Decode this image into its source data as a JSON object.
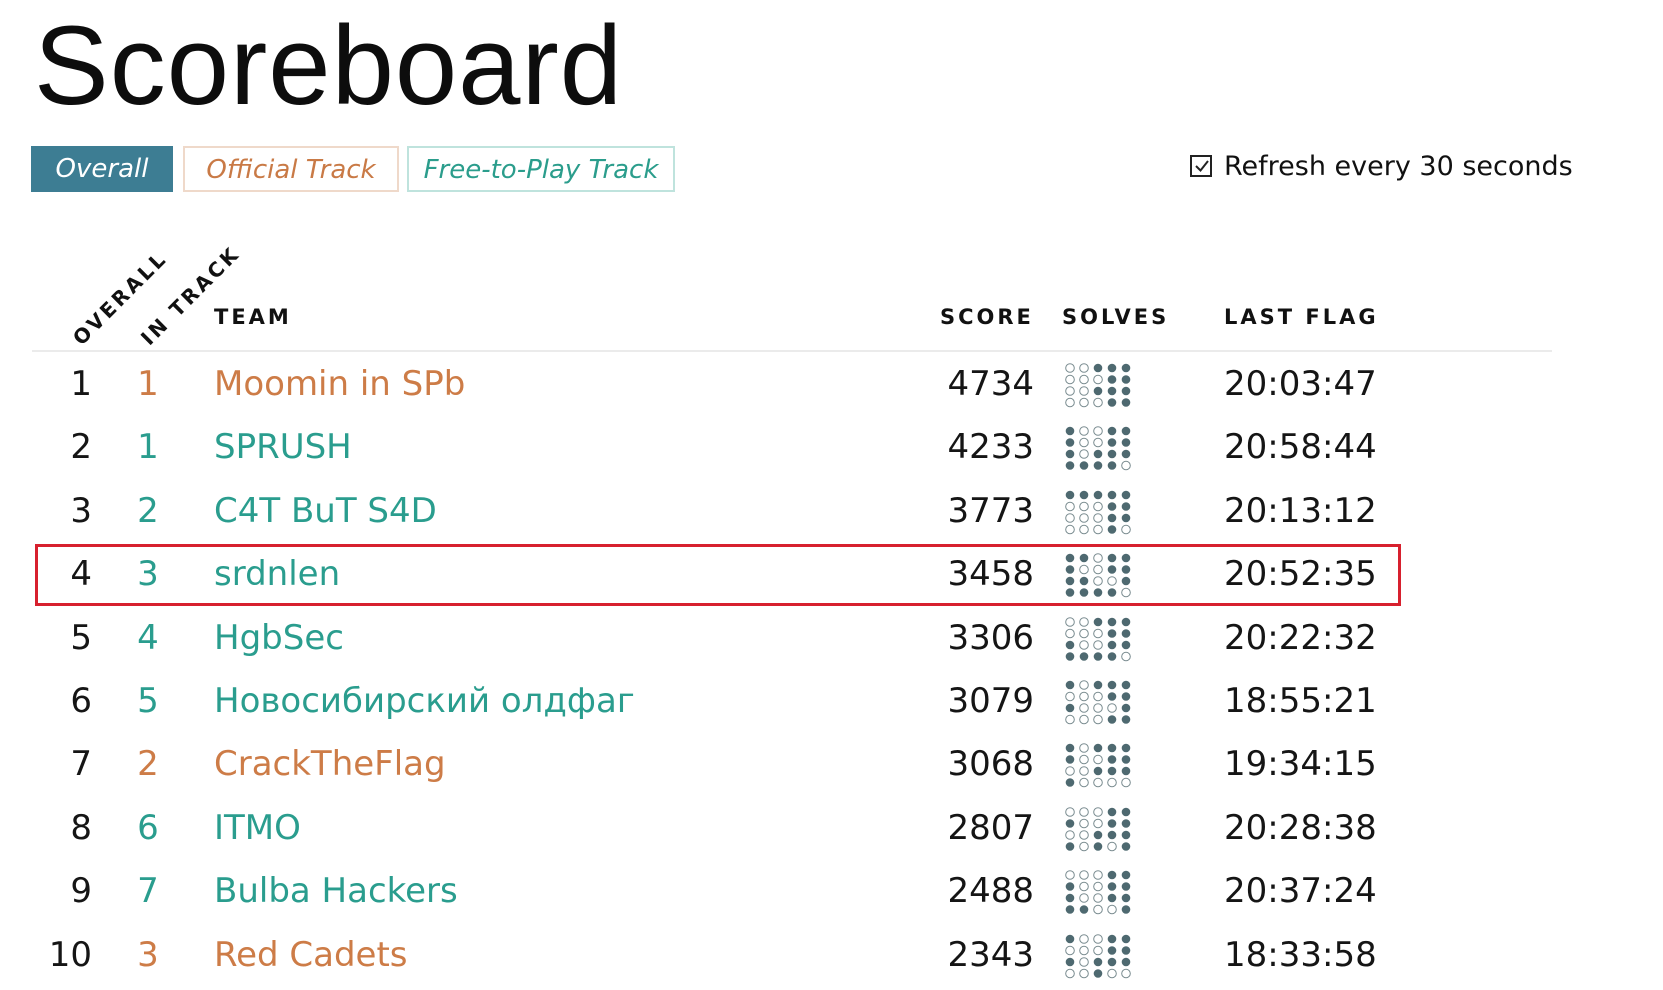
{
  "page": {
    "title": "Scoreboard"
  },
  "tabs": [
    {
      "label": "Overall",
      "active": true
    },
    {
      "label": "Official Track",
      "active": false
    },
    {
      "label": "Free-to-Play Track",
      "active": false
    }
  ],
  "refresh": {
    "label": "Refresh every 30 seconds",
    "checked": true
  },
  "columns": {
    "overall": "OVERALL",
    "in_track": "IN TRACK",
    "team": "TEAM",
    "score": "SCORE",
    "solves": "SOLVES",
    "last_flag": "LAST FLAG"
  },
  "colors": {
    "official_track": "#cd7c47",
    "free_track": "#2a9d8e",
    "active_tab": "#3d7d93",
    "solve_dot": "#4e6970",
    "highlight": "#d7202e"
  },
  "rows": [
    {
      "overall": "1",
      "in_track": "1",
      "team": "Moomin in SPb",
      "track": "official",
      "score": "4734",
      "last_flag": "20:03:47",
      "solves": [
        0,
        0,
        1,
        1,
        1,
        0,
        0,
        0,
        1,
        1,
        0,
        0,
        1,
        1,
        1,
        0,
        0,
        0,
        1,
        1
      ],
      "highlighted": false
    },
    {
      "overall": "2",
      "in_track": "1",
      "team": "SPRUSH",
      "track": "free",
      "score": "4233",
      "last_flag": "20:58:44",
      "solves": [
        1,
        0,
        0,
        1,
        1,
        1,
        0,
        0,
        1,
        1,
        1,
        0,
        1,
        1,
        1,
        1,
        1,
        1,
        1,
        0
      ],
      "highlighted": false
    },
    {
      "overall": "3",
      "in_track": "2",
      "team": "C4T BuT S4D",
      "track": "free",
      "score": "3773",
      "last_flag": "20:13:12",
      "solves": [
        1,
        1,
        1,
        1,
        1,
        0,
        0,
        0,
        1,
        1,
        0,
        0,
        0,
        1,
        1,
        0,
        0,
        0,
        1,
        0
      ],
      "highlighted": false
    },
    {
      "overall": "4",
      "in_track": "3",
      "team": "srdnlen",
      "track": "free",
      "score": "3458",
      "last_flag": "20:52:35",
      "solves": [
        1,
        1,
        0,
        1,
        1,
        1,
        0,
        0,
        1,
        1,
        1,
        1,
        0,
        0,
        1,
        1,
        1,
        1,
        1,
        0
      ],
      "highlighted": true
    },
    {
      "overall": "5",
      "in_track": "4",
      "team": "HgbSec",
      "track": "free",
      "score": "3306",
      "last_flag": "20:22:32",
      "solves": [
        0,
        0,
        1,
        1,
        1,
        0,
        0,
        0,
        1,
        1,
        1,
        0,
        0,
        1,
        1,
        1,
        1,
        1,
        1,
        0
      ],
      "highlighted": false
    },
    {
      "overall": "6",
      "in_track": "5",
      "team": "Новосибирский олдфаг",
      "track": "free",
      "score": "3079",
      "last_flag": "18:55:21",
      "solves": [
        1,
        0,
        1,
        1,
        1,
        0,
        0,
        0,
        1,
        1,
        1,
        0,
        0,
        0,
        1,
        0,
        0,
        0,
        1,
        1
      ],
      "highlighted": false
    },
    {
      "overall": "7",
      "in_track": "2",
      "team": "CrackTheFlag",
      "track": "official",
      "score": "3068",
      "last_flag": "19:34:15",
      "solves": [
        1,
        0,
        1,
        1,
        1,
        1,
        0,
        0,
        1,
        1,
        0,
        0,
        1,
        1,
        1,
        1,
        0,
        0,
        0,
        0
      ],
      "highlighted": false
    },
    {
      "overall": "8",
      "in_track": "6",
      "team": "ITMO",
      "track": "free",
      "score": "2807",
      "last_flag": "20:28:38",
      "solves": [
        0,
        0,
        0,
        1,
        1,
        1,
        0,
        0,
        1,
        1,
        0,
        0,
        1,
        1,
        1,
        1,
        0,
        1,
        0,
        1
      ],
      "highlighted": false
    },
    {
      "overall": "9",
      "in_track": "7",
      "team": "Bulba Hackers",
      "track": "free",
      "score": "2488",
      "last_flag": "20:37:24",
      "solves": [
        0,
        0,
        0,
        1,
        1,
        1,
        0,
        0,
        1,
        1,
        1,
        0,
        0,
        1,
        1,
        1,
        1,
        0,
        0,
        1
      ],
      "highlighted": false
    },
    {
      "overall": "10",
      "in_track": "3",
      "team": "Red Cadets",
      "track": "official",
      "score": "2343",
      "last_flag": "18:33:58",
      "solves": [
        1,
        0,
        0,
        1,
        1,
        0,
        0,
        0,
        1,
        1,
        1,
        0,
        1,
        1,
        1,
        0,
        0,
        1,
        0,
        0
      ],
      "highlighted": false
    }
  ]
}
